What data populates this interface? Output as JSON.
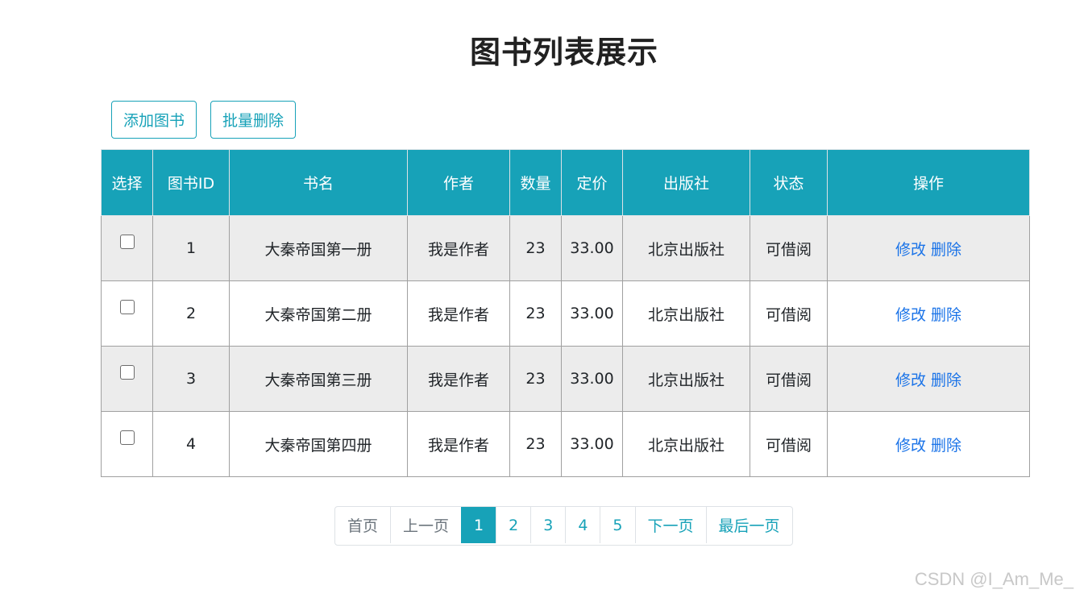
{
  "page": {
    "title": "图书列表展示"
  },
  "toolbar": {
    "add_label": "添加图书",
    "batch_delete_label": "批量删除"
  },
  "table": {
    "headers": [
      "选择",
      "图书ID",
      "书名",
      "作者",
      "数量",
      "定价",
      "出版社",
      "状态",
      "操作"
    ],
    "rows": [
      {
        "id": "1",
        "name": "大秦帝国第一册",
        "author": "我是作者",
        "count": "23",
        "price": "33.00",
        "publisher": "北京出版社",
        "status": "可借阅"
      },
      {
        "id": "2",
        "name": "大秦帝国第二册",
        "author": "我是作者",
        "count": "23",
        "price": "33.00",
        "publisher": "北京出版社",
        "status": "可借阅"
      },
      {
        "id": "3",
        "name": "大秦帝国第三册",
        "author": "我是作者",
        "count": "23",
        "price": "33.00",
        "publisher": "北京出版社",
        "status": "可借阅"
      },
      {
        "id": "4",
        "name": "大秦帝国第四册",
        "author": "我是作者",
        "count": "23",
        "price": "33.00",
        "publisher": "北京出版社",
        "status": "可借阅"
      }
    ],
    "edit_label": "修改",
    "delete_label": "删除"
  },
  "pagination": {
    "first": "首页",
    "prev": "上一页",
    "pages": [
      "1",
      "2",
      "3",
      "4",
      "5"
    ],
    "active_page": "1",
    "next": "下一页",
    "last": "最后一页"
  },
  "watermark": "CSDN @I_Am_Me_",
  "colors": {
    "accent": "#17a2b8",
    "link": "#1a73e8",
    "striped_row": "#ececec"
  }
}
